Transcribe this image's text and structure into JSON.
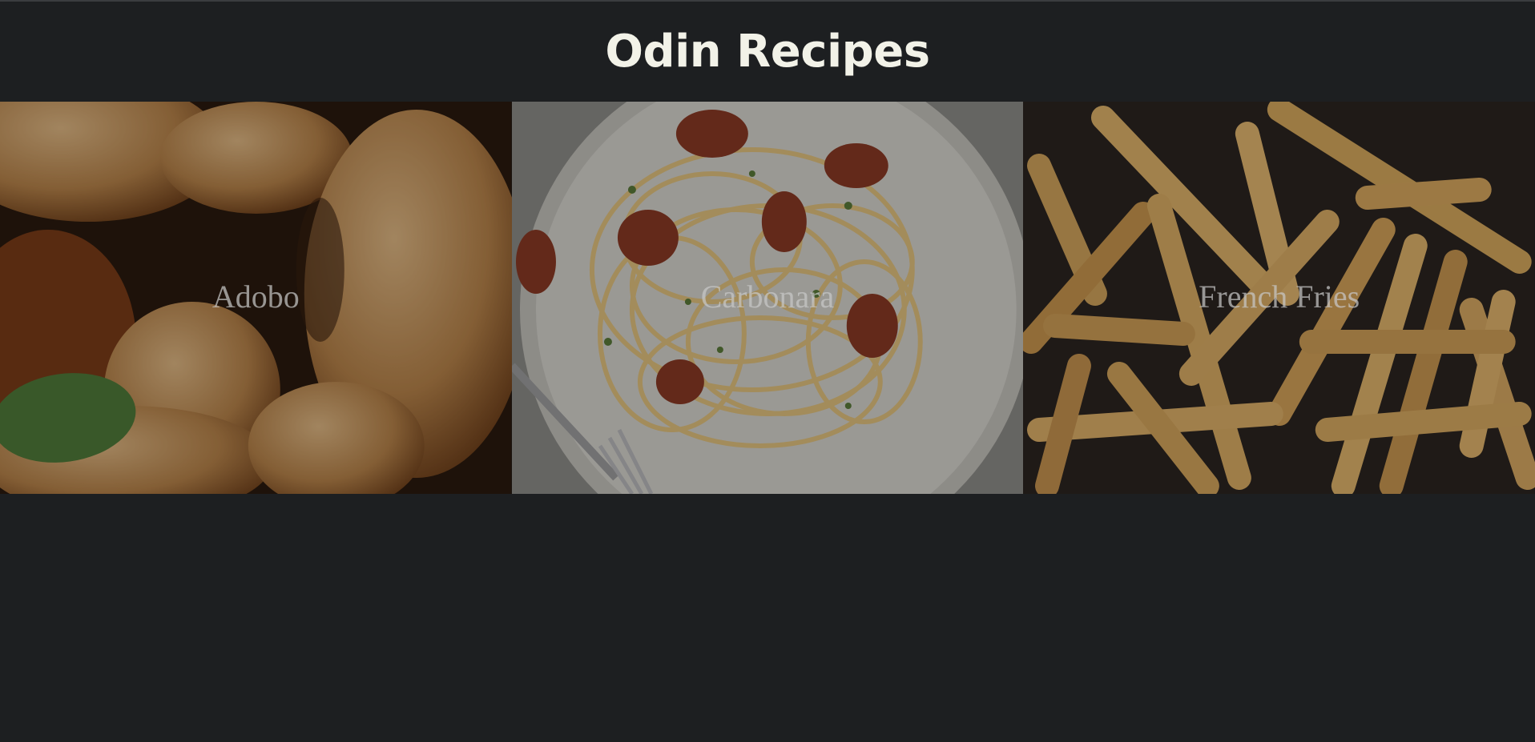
{
  "page": {
    "title": "Odin Recipes"
  },
  "recipes": [
    {
      "name": "Adobo",
      "photo": "roast-chicken-photo",
      "tone": "#8a5a2e"
    },
    {
      "name": "Carbonara",
      "photo": "spaghetti-carbonara-photo",
      "tone": "#b9b6ae"
    },
    {
      "name": "French Fries",
      "photo": "french-fries-photo",
      "tone": "#9c6a2a"
    }
  ],
  "theme": {
    "background": "#1d1f21",
    "title_color": "#f2f2e8",
    "label_color": "#c8c8c8"
  }
}
